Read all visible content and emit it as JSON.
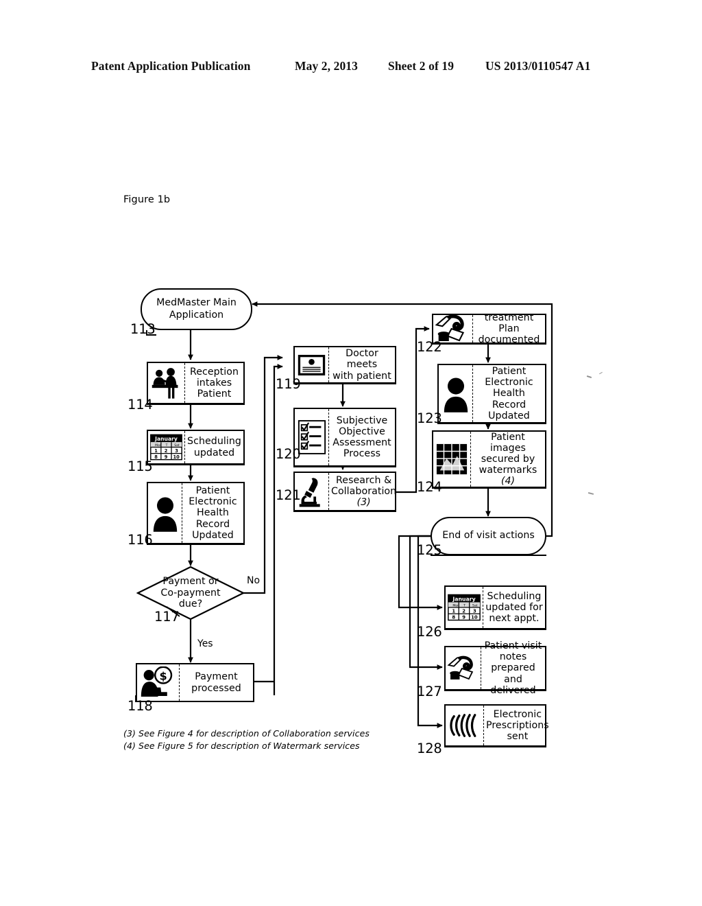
{
  "header": {
    "publication": "Patent Application Publication",
    "date": "May 2, 2013",
    "sheet": "Sheet 2 of 19",
    "patent_number": "US 2013/0110547 A1"
  },
  "figure": {
    "title": "Figure 1b"
  },
  "nodes": [
    {
      "ref": "113",
      "shape": "stadium",
      "label": "MedMaster Main\nApplication",
      "line1": "MedMaster Main",
      "line2": "Application",
      "icon": null
    },
    {
      "ref": "114",
      "shape": "process",
      "line1": "Reception",
      "line2": "intakes",
      "line3": "Patient",
      "icon": "reception-desk-icon"
    },
    {
      "ref": "115",
      "shape": "process",
      "line1": "Scheduling",
      "line2": "updated",
      "icon": "calendar-icon"
    },
    {
      "ref": "116",
      "shape": "process",
      "line1": "Patient",
      "line2": "Electronic",
      "line3": "Health Record",
      "line4": "Updated",
      "icon": "person-icon"
    },
    {
      "ref": "117",
      "shape": "decision",
      "line1": "Payment or",
      "line2": "Co-payment",
      "line3": "due?",
      "icon": null,
      "branch_yes": "Yes",
      "branch_no": "No"
    },
    {
      "ref": "118",
      "shape": "process",
      "line1": "Payment",
      "line2": "processed",
      "icon": "payment-icon"
    },
    {
      "ref": "119",
      "shape": "process",
      "line1": "Doctor meets",
      "line2": "with patient",
      "icon": "monitor-icon"
    },
    {
      "ref": "120",
      "shape": "process",
      "line1": "Subjective",
      "line2": "Objective",
      "line3": "Assessment",
      "line4": "Process",
      "icon": "checklist-icon"
    },
    {
      "ref": "121",
      "shape": "process",
      "line1": "Research &",
      "line2": "Collaboration",
      "note": "(3)",
      "icon": "microscope-icon"
    },
    {
      "ref": "122",
      "shape": "process",
      "line1": "treatment Plan",
      "line2": "documented",
      "icon": "prescription-pen-icon"
    },
    {
      "ref": "123",
      "shape": "process",
      "line1": "Patient",
      "line2": "Electronic",
      "line3": "Health Record",
      "line4": "Updated",
      "icon": "person-icon"
    },
    {
      "ref": "124",
      "shape": "process",
      "line1": "Patient images",
      "line2": "secured by",
      "line3": "watermarks",
      "note": "(4)",
      "icon": "watermark-image-icon"
    },
    {
      "ref": "125",
      "shape": "stadium",
      "line1": "End of visit actions",
      "icon": null
    },
    {
      "ref": "126",
      "shape": "process",
      "line1": "Scheduling",
      "line2": "updated for",
      "line3": "next appt.",
      "icon": "calendar-icon"
    },
    {
      "ref": "127",
      "shape": "process",
      "line1": "Patient visit",
      "line2": "notes prepared",
      "line3": "and delivered",
      "icon": "prescription-pen-icon"
    },
    {
      "ref": "128",
      "shape": "process",
      "line1": "Electronic",
      "line2": "Prescriptions",
      "line3": "sent",
      "icon": "wireless-signal-icon"
    }
  ],
  "calendar": {
    "month": "January",
    "weekdays": [
      "Mon",
      "T",
      "Sat"
    ],
    "row1": [
      "1",
      "2",
      "3"
    ],
    "row2": [
      "8",
      "9",
      "10"
    ]
  },
  "footnotes": {
    "line1": "(3) See Figure 4 for description of Collaboration services",
    "line2": "(4) See Figure 5 for description of Watermark services"
  },
  "colors": {
    "ink": "#000000",
    "paper": "#ffffff"
  }
}
